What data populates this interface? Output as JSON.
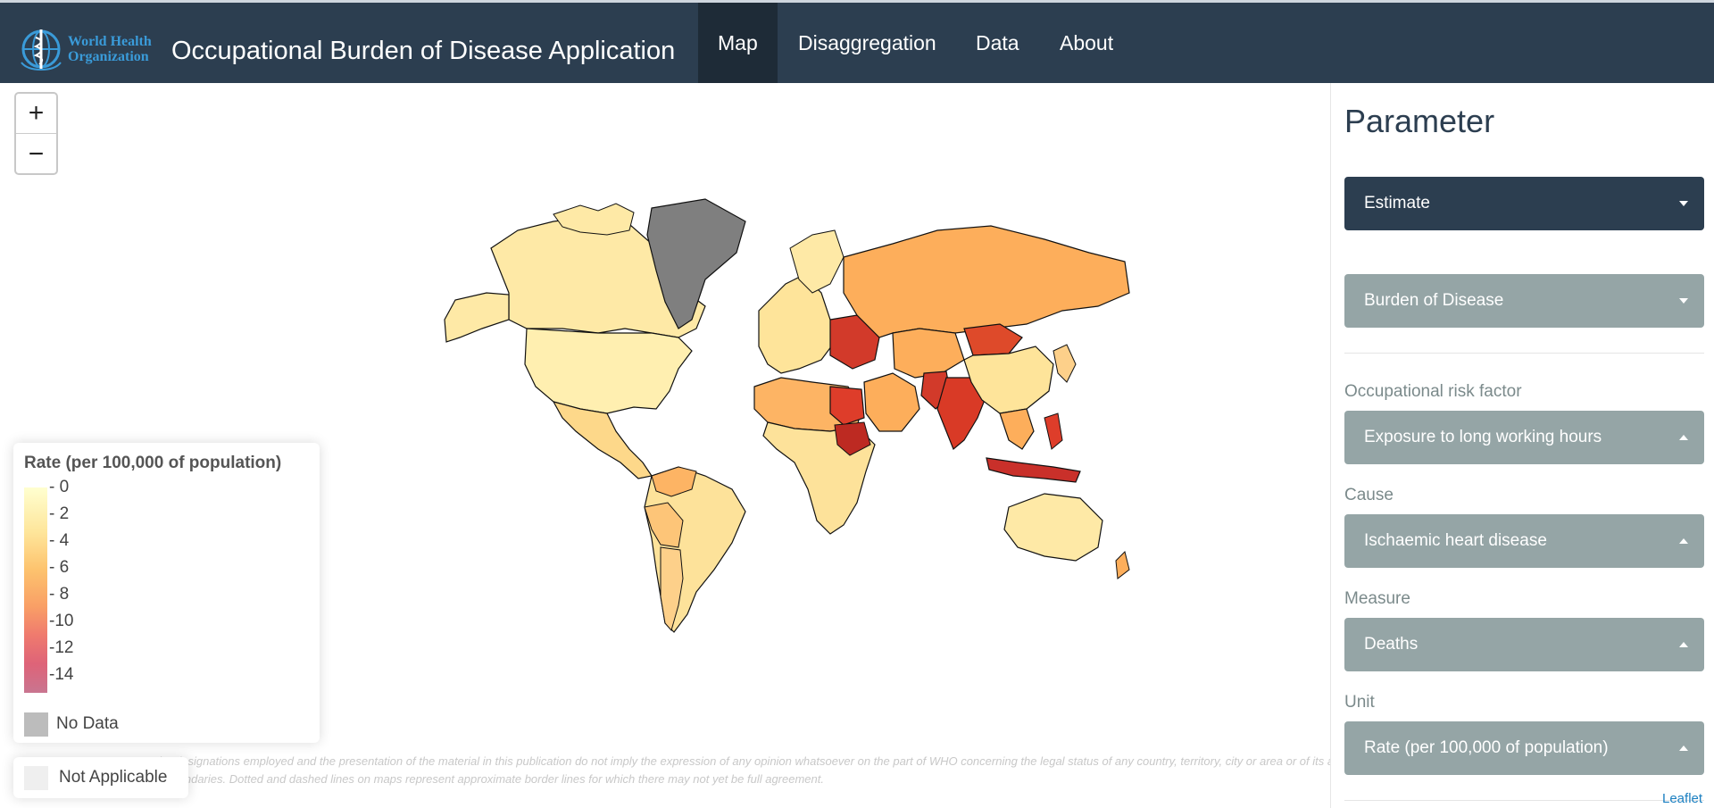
{
  "navbar": {
    "logo_text_line1": "World Health",
    "logo_text_line2": "Organization",
    "title": "Occupational Burden of Disease Application",
    "tabs": [
      {
        "label": "Map",
        "active": true
      },
      {
        "label": "Disaggregation",
        "active": false
      },
      {
        "label": "Data",
        "active": false
      },
      {
        "label": "About",
        "active": false
      }
    ],
    "background_color": "#2c3e50"
  },
  "map": {
    "zoom_in_label": "+",
    "zoom_out_label": "−",
    "attribution": "Leaflet"
  },
  "legend": {
    "title": "Rate (per 100,000 of population)",
    "ticks": [
      "0",
      "2",
      "4",
      "6",
      "8",
      "10",
      "12",
      "14"
    ],
    "no_data_label": "No Data",
    "not_applicable_label": "Not Applicable",
    "colors": [
      "#ffffcc",
      "#fed976",
      "#feb24c",
      "#fd8d3c",
      "#f03b20",
      "#bd0026"
    ],
    "no_data_color": "#808080"
  },
  "disclaimer": {
    "line1": "The designations employed and the presentation of the material in this publication do not imply the expression of any opinion whatsoever on the part of WHO concerning the legal status of any country, territory, city or area or of its authorities, or concerning the delimitation of its frontiers",
    "line2": "or boundaries. Dotted and dashed lines on maps represent approximate border lines for which there may not yet be full agreement."
  },
  "sidebar": {
    "title": "Parameter",
    "estimate": "Estimate",
    "burden": "Burden of Disease",
    "risk_factor_label": "Occupational risk factor",
    "risk_factor_value": "Exposure to long working hours",
    "cause_label": "Cause",
    "cause_value": "Ischaemic heart disease",
    "measure_label": "Measure",
    "measure_value": "Deaths",
    "unit_label": "Unit",
    "unit_value": "Rate (per 100,000 of population)",
    "primary_color": "#2c3e50",
    "secondary_color": "#95a5a6"
  }
}
